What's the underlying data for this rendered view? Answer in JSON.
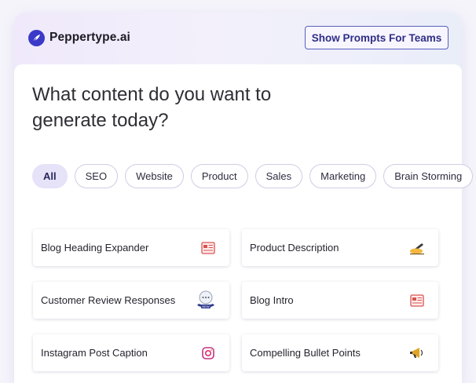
{
  "header": {
    "brand_name": "Peppertype.ai",
    "teams_button_label": "Show Prompts For Teams"
  },
  "main": {
    "heading": "What content do you want to generate today?",
    "filters": [
      "All",
      "SEO",
      "Website",
      "Product",
      "Sales",
      "Marketing",
      "Brain Storming"
    ],
    "active_filter": "All",
    "cards": [
      {
        "label": "Blog Heading Expander",
        "icon": "article-icon"
      },
      {
        "label": "Product Description",
        "icon": "writing-hand-icon"
      },
      {
        "label": "Customer Review Responses",
        "icon": "chat-bubble-new-icon",
        "badge": "NEW"
      },
      {
        "label": "Blog Intro",
        "icon": "article-icon"
      },
      {
        "label": "Instagram Post Caption",
        "icon": "instagram-icon"
      },
      {
        "label": "Compelling Bullet Points",
        "icon": "megaphone-icon"
      }
    ]
  },
  "colors": {
    "brand": "#3b39c8",
    "button_border": "#5a5fbd",
    "active_chip_bg": "#e6e2f8",
    "icon_red": "#d9534f"
  }
}
